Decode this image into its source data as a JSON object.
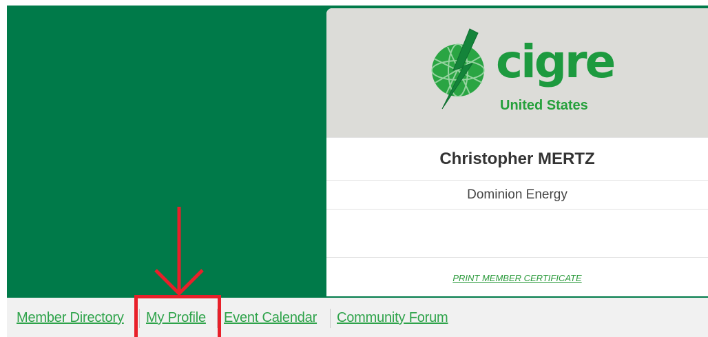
{
  "logo": {
    "wordmark": "cigre",
    "subtitle": "United States"
  },
  "member": {
    "name": "Christopher MERTZ",
    "company": "Dominion Energy",
    "certificate_link": "PRINT MEMBER CERTIFICATE"
  },
  "nav": {
    "items": [
      {
        "label": "Member Directory"
      },
      {
        "label": "My Profile"
      },
      {
        "label": "Event Calendar"
      },
      {
        "label": "Community Forum"
      }
    ]
  },
  "colors": {
    "brand_green": "#007a49",
    "link_green": "#2ea34a",
    "annotation_red": "#e8202a"
  }
}
